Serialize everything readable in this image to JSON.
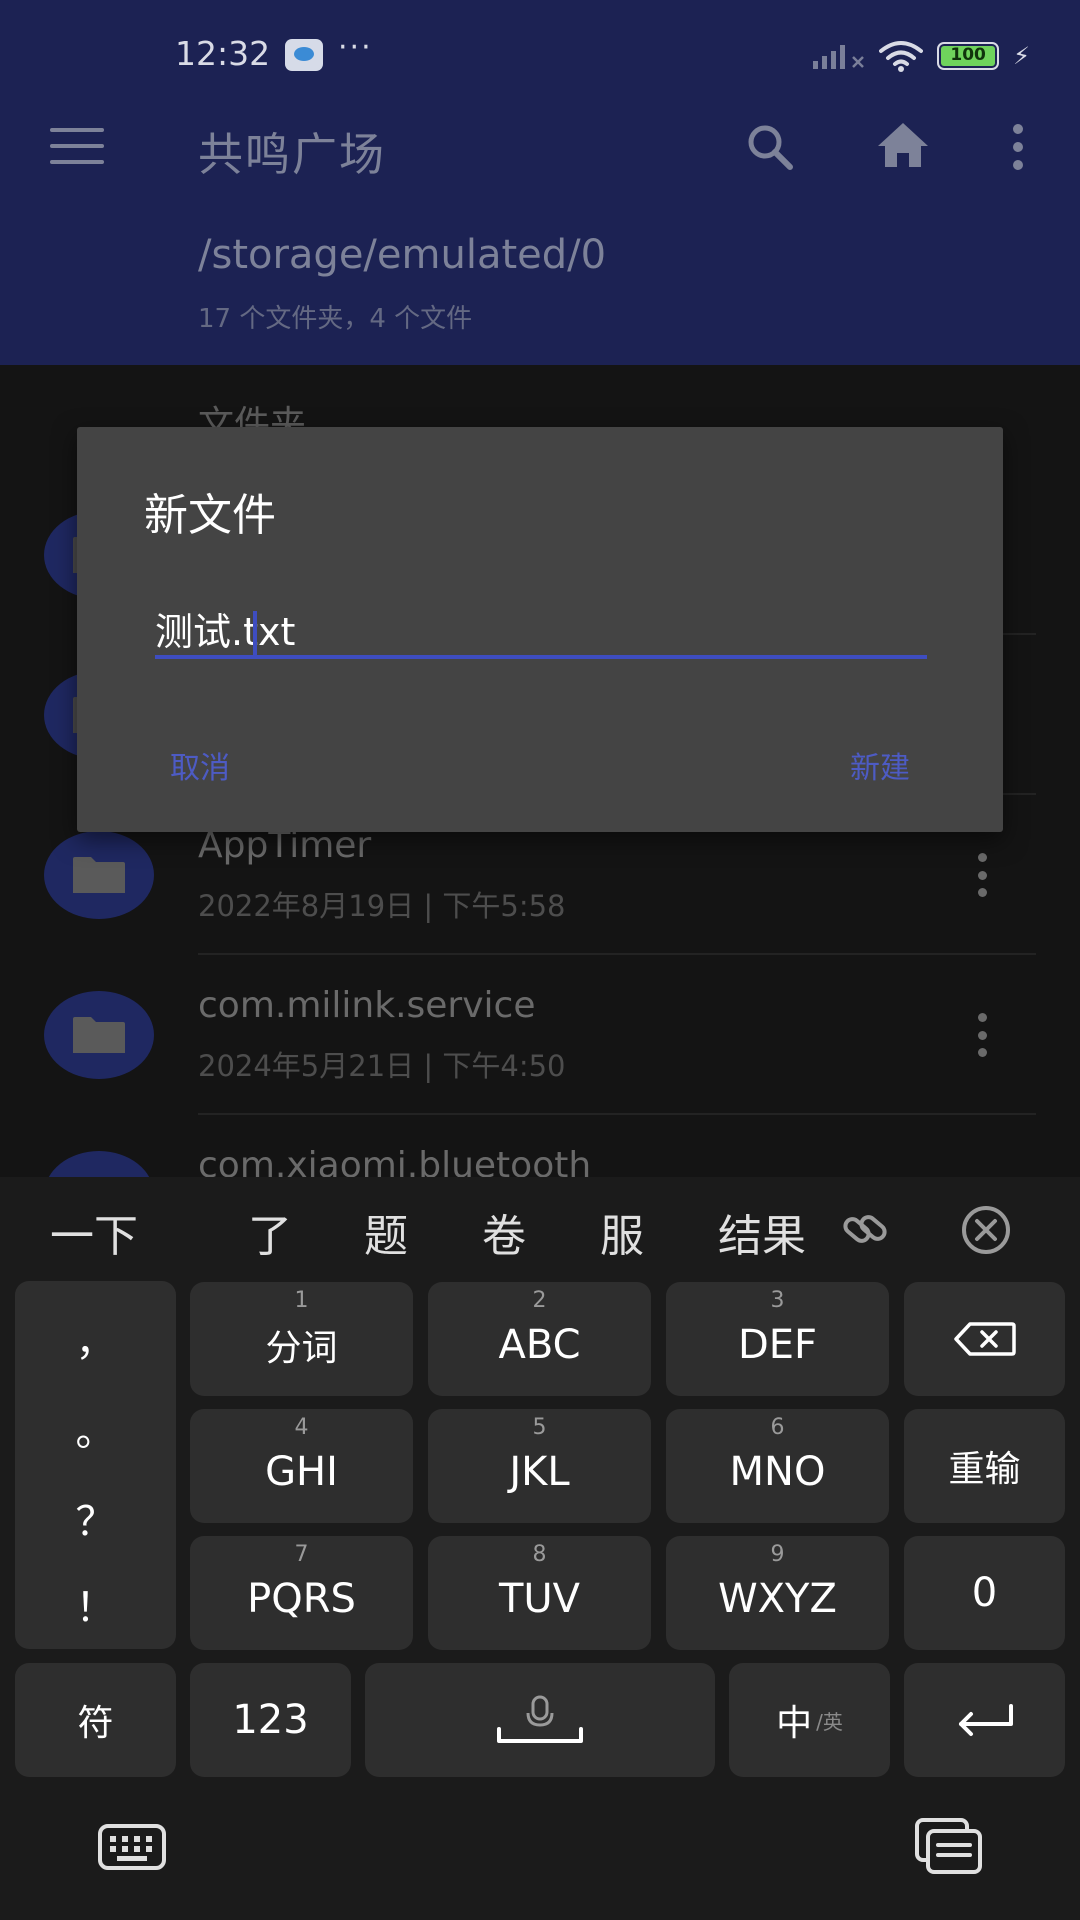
{
  "status_bar": {
    "time": "12:32",
    "more": "···",
    "battery": "100",
    "icons": [
      "app-notification-icon",
      "signal-icon",
      "wifi-icon",
      "battery-icon",
      "charging-icon"
    ]
  },
  "app_bar": {
    "title": "共鸣广场",
    "path": "/storage/emulated/0",
    "summary": "17 个文件夹，4 个文件",
    "icons": [
      "menu-icon",
      "search-icon",
      "home-icon",
      "overflow-icon"
    ]
  },
  "list": {
    "section_label": "文件夹",
    "items": [
      {
        "name": "",
        "meta": ""
      },
      {
        "name": "",
        "meta": ""
      },
      {
        "name": "AppTimer",
        "meta": "2022年8月19日 | 下午5:58"
      },
      {
        "name": "com.milink.service",
        "meta": "2024年5月21日 | 下午4:50"
      },
      {
        "name": "com.xiaomi.bluetooth",
        "meta": ""
      }
    ]
  },
  "dialog": {
    "title": "新文件",
    "input_value": "测试.txt",
    "cancel_label": "取消",
    "create_label": "新建"
  },
  "keyboard": {
    "candidates": [
      "一下",
      "了",
      "题",
      "卷",
      "服",
      "结果"
    ],
    "punctuation": [
      "，",
      "。",
      "？",
      "！"
    ],
    "rows": [
      [
        {
          "num": "1",
          "label": "分词"
        },
        {
          "num": "2",
          "label": "ABC"
        },
        {
          "num": "3",
          "label": "DEF"
        }
      ],
      [
        {
          "num": "4",
          "label": "GHI"
        },
        {
          "num": "5",
          "label": "JKL"
        },
        {
          "num": "6",
          "label": "MNO"
        }
      ],
      [
        {
          "num": "7",
          "label": "PQRS"
        },
        {
          "num": "8",
          "label": "TUV"
        },
        {
          "num": "9",
          "label": "WXYZ"
        }
      ]
    ],
    "reenter_label": "重输",
    "zero_label": "0",
    "symbols_label": "符",
    "numbers_label": "123",
    "lang_label": "中",
    "lang_alt_label": "/英",
    "accent_color": "#3e4dc0"
  }
}
